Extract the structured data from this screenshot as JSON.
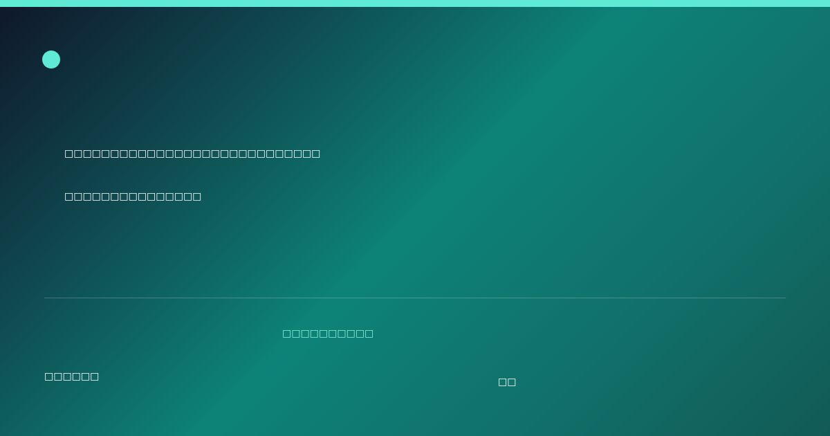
{
  "colors": {
    "accent": "#5eead4",
    "link": "#8ff0dc",
    "text": "#ffffff",
    "background_start": "#0f172a",
    "background_mid": "#0d8378",
    "background_end": "#125a55"
  },
  "brand": {
    "icon": "circle-logo-icon"
  },
  "hero": {
    "headline": "□□□□□□□□□□□□□□□□□□□□□□□□□□□□",
    "subline": "□□□□□□□□□□□□□□□"
  },
  "footer": {
    "link_text": "□□□□□□□□□□",
    "left_text": "□□□□□□",
    "right_text": "□□"
  }
}
